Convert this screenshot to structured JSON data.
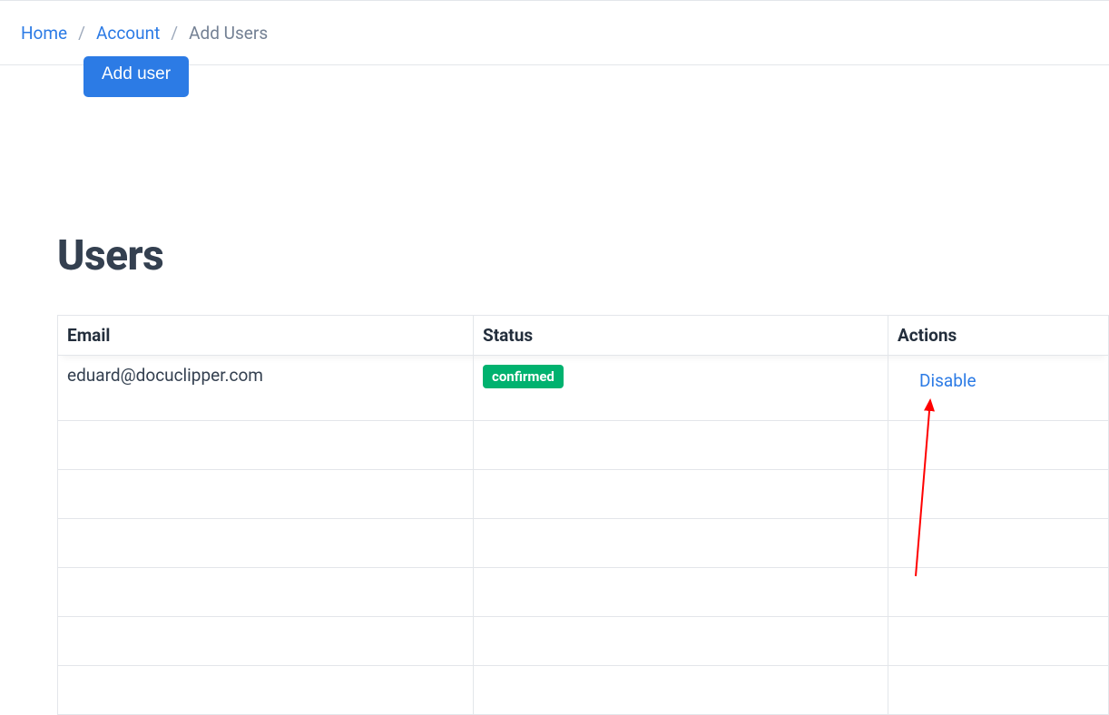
{
  "breadcrumb": {
    "items": [
      {
        "label": "Home",
        "link": true
      },
      {
        "label": "Account",
        "link": true
      },
      {
        "label": "Add Users",
        "link": false
      }
    ]
  },
  "buttons": {
    "add_user": "Add user"
  },
  "page": {
    "title": "Users"
  },
  "table": {
    "headers": {
      "email": "Email",
      "status": "Status",
      "actions": "Actions"
    },
    "rows": [
      {
        "email": "eduard@docuclipper.com",
        "status": "confirmed",
        "action": "Disable"
      }
    ]
  }
}
